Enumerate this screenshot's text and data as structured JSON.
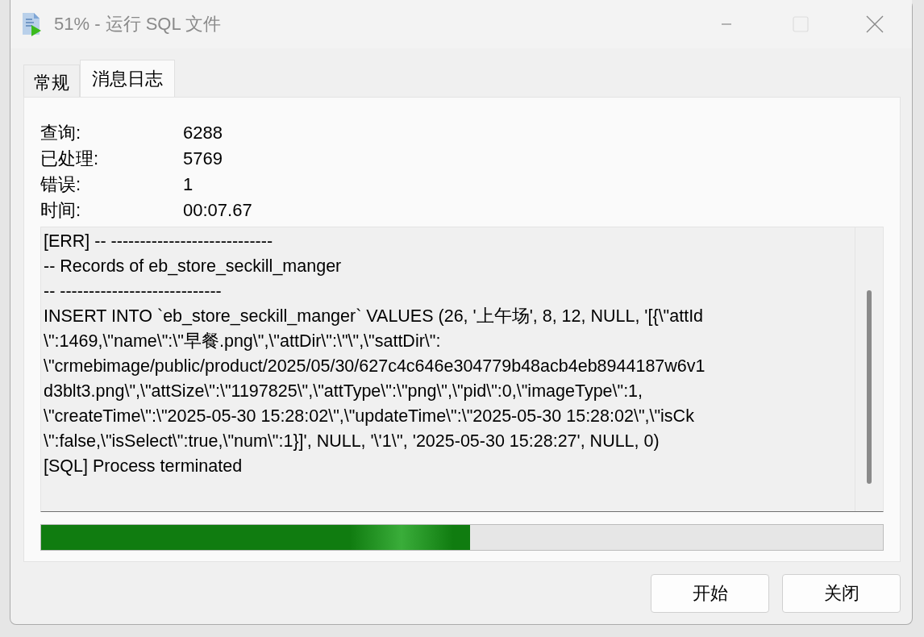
{
  "window": {
    "title": "51% - 运行 SQL 文件",
    "maximize_disabled": true
  },
  "tabs": [
    {
      "label": "常规",
      "selected": false
    },
    {
      "label": "消息日志",
      "selected": true
    }
  ],
  "stats": [
    {
      "label": "查询:",
      "value": "6288"
    },
    {
      "label": "已处理:",
      "value": "5769"
    },
    {
      "label": "错误:",
      "value": "1"
    },
    {
      "label": "时间:",
      "value": "00:07.67"
    }
  ],
  "log": [
    "[ERR] -- ----------------------------",
    "-- Records of eb_store_seckill_manger",
    "-- ----------------------------",
    "INSERT INTO `eb_store_seckill_manger` VALUES (26, '上午场', 8, 12, NULL, '[{\\\"attId",
    "\\\":1469,\\\"name\\\":\\\"早餐.png\\\",\\\"attDir\\\":\\\"\\\",\\\"sattDir\\\":",
    "\\\"crmebimage/public/product/2025/05/30/627c4c646e304779b48acb4eb8944187w6v1",
    "d3blt3.png\\\",\\\"attSize\\\":\\\"1197825\\\",\\\"attType\\\":\\\"png\\\",\\\"pid\\\":0,\\\"imageType\\\":1,",
    "\\\"createTime\\\":\\\"2025-05-30 15:28:02\\\",\\\"updateTime\\\":\\\"2025-05-30 15:28:02\\\",\\\"isCk",
    "\\\":false,\\\"isSelect\\\":true,\\\"num\\\":1}]', NULL, '\\'1\\'', '2025-05-30 15:28:27', NULL, 0)",
    "[SQL] Process terminated"
  ],
  "progress": {
    "level": 0.51
  },
  "buttons": [
    "开始",
    "关闭"
  ]
}
